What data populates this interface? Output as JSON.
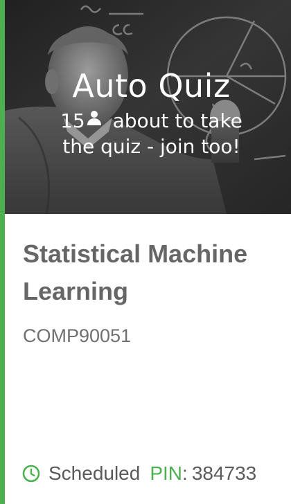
{
  "hero": {
    "title": "Auto Quiz",
    "participant_count": "15",
    "participant_icon": "person-icon",
    "subtitle_line1": "about to take",
    "subtitle_line2": "the quiz - join too!"
  },
  "course": {
    "title": "Statistical Machine Learning",
    "code": "COMP90051"
  },
  "footer": {
    "status_icon": "clock-icon",
    "status": "Scheduled",
    "pin_label": "PIN",
    "pin_value": "384733"
  },
  "colors": {
    "accent": "#4caf50",
    "title_text": "#666666",
    "body_text": "#5a5a5a"
  }
}
